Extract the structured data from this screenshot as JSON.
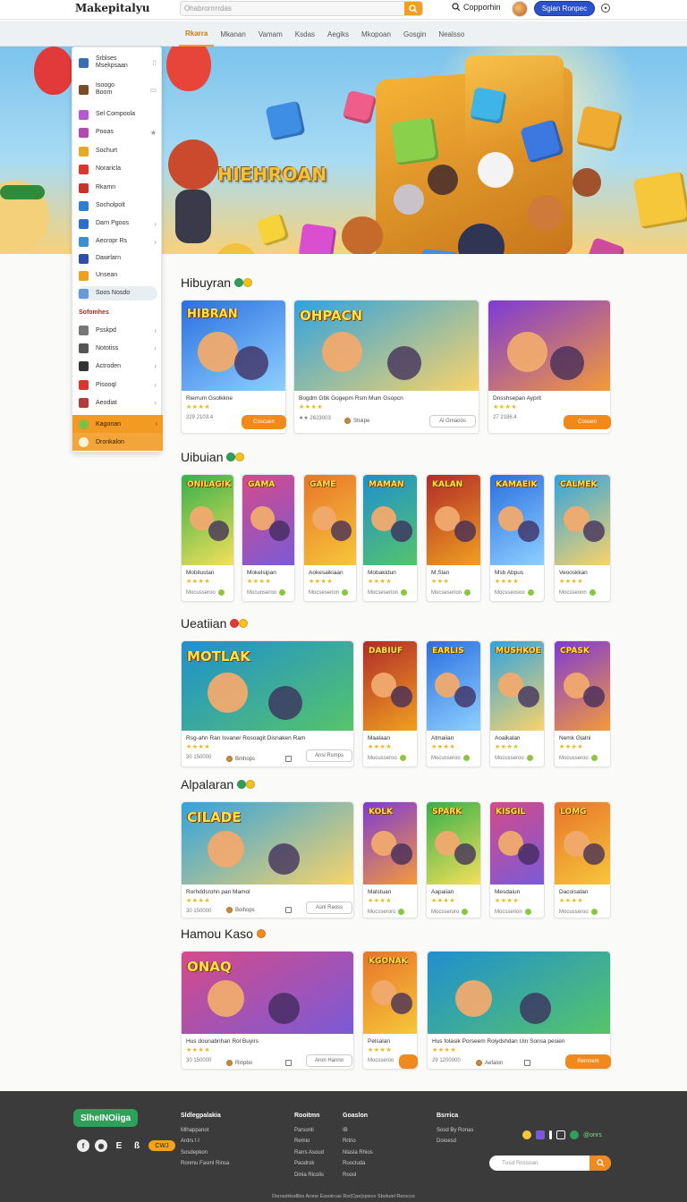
{
  "header": {
    "logo": "Makepitalyu",
    "search_placeholder": "Ohabrorrrrrdas",
    "link": "Copporhin",
    "signin": "Sgian Ronpec"
  },
  "nav": {
    "categories": [
      "Rkarra",
      "Mkanan",
      "Vamam",
      "Ksdas",
      "Aegiks",
      "Mkopoan",
      "Gosgin",
      "Nealsso"
    ]
  },
  "hero": {
    "title": "HIEHROAN"
  },
  "sidebar": {
    "items": [
      {
        "label": "Srblses\nMsekpsaan",
        "arrow": "⁞⁞",
        "color": "#3c6db3"
      },
      {
        "label": "Isoogo\nBoom",
        "arrow": "▭",
        "color": "#7a4c28"
      },
      {
        "label": "Sel Compoola",
        "arrow": "",
        "color": "#b55bd1"
      },
      {
        "label": "Pooas",
        "arrow": "★",
        "color": "#b04ab0"
      },
      {
        "label": "Sochurt",
        "arrow": "",
        "color": "#e8a82a"
      },
      {
        "label": "Noraricla",
        "arrow": "",
        "color": "#d9362d"
      },
      {
        "label": "Rkamn",
        "arrow": "",
        "color": "#c8322b"
      },
      {
        "label": "Socholpolt",
        "arrow": "",
        "color": "#2f7fcf"
      },
      {
        "label": "Darn Pgoos",
        "arrow": "›",
        "color": "#2b6fc7"
      },
      {
        "label": "Aecropr Rs",
        "arrow": "›",
        "color": "#3b8ed0"
      },
      {
        "label": "Dawrlarn",
        "arrow": "",
        "color": "#2c4fa8"
      },
      {
        "label": "Unsean",
        "arrow": "",
        "color": "#f0a020"
      },
      {
        "label": "Soos Nosdo",
        "arrow": "",
        "color": "#6a9ad6"
      }
    ],
    "section_title": "Sofomhes",
    "section_items": [
      {
        "label": "Psskpd",
        "arrow": "›",
        "color": "#777777"
      },
      {
        "label": "Nototiss",
        "arrow": "›",
        "color": "#555555"
      },
      {
        "label": "Actroden",
        "arrow": "›",
        "color": "#333333"
      },
      {
        "label": "Pisooql",
        "arrow": "›",
        "color": "#d9362d"
      },
      {
        "label": "Aeodiat",
        "arrow": "›",
        "color": "#b13b3b"
      }
    ],
    "promo_items": [
      {
        "label": "Kagonan",
        "arrow": "›"
      },
      {
        "label": "Dronkalon",
        "arrow": ""
      }
    ]
  },
  "sections": [
    {
      "title": "Hibuyran",
      "cards": [
        {
          "name": "Rierrum Gsolkkne",
          "stars": "★★★★",
          "meta": "229  2103.4",
          "button": "Coscuen",
          "art": "HIBRAN"
        },
        {
          "name": "Bogdm Gbk Gogepm Rsm Mum Gsopcn",
          "stars": "★★★★",
          "meta": "★★  2623003",
          "mini": "Stskpe",
          "button": "Al  Gmaoos",
          "art": "OHPACN"
        },
        {
          "name": "Dnsshsepan Ayprit",
          "stars": "★★★★",
          "meta": "27  2186.4",
          "button": "Cosuen",
          "art": ""
        }
      ]
    },
    {
      "title": "Uibuian",
      "cards": [
        {
          "name": "Mobilustan",
          "stars": "★★★★",
          "meta": "Mocusseroo",
          "art": "ONILAGIK"
        },
        {
          "name": "Mokelsipan",
          "stars": "★★★★",
          "meta": "Mocunseroo",
          "art": "GAMA"
        },
        {
          "name": "Aokesaikiaan",
          "stars": "★★★★",
          "meta": "Mocseserion",
          "art": "GAME"
        },
        {
          "name": "Mobakidun",
          "stars": "★★★★",
          "meta": "Mocseserion",
          "art": "MAMAN"
        },
        {
          "name": "M.Slan",
          "stars": "★★★",
          "meta": "Mocseserion",
          "art": "KALAN"
        },
        {
          "name": "Msb Abpus",
          "stars": "★★★★",
          "meta": "Mocsseosoo",
          "art": "KAMAEIK"
        },
        {
          "name": "Veooskkan",
          "stars": "★★★★",
          "meta": "Mocsseonn",
          "art": "CALMEK"
        }
      ]
    },
    {
      "title": "Ueatiian",
      "cards": [
        {
          "name": "Rsg-ahn Ran Isvaner Rosoagit Disnaken Ram",
          "stars": "★★★★",
          "meta": "30  150000",
          "mini": "Bmhops",
          "button": "Ansi Rsmps",
          "art": "MOTLAK"
        },
        {
          "name": "Maalaan",
          "stars": "★★★★",
          "meta": "Mocusseroo",
          "art": "DABIUF"
        },
        {
          "name": "Atmaiian",
          "stars": "★★★★",
          "meta": "Mocusseroo",
          "art": "EARLIS"
        },
        {
          "name": "Aoaikalan",
          "stars": "★★★★",
          "meta": "Mocusseroo",
          "art": "MUSHKOE"
        },
        {
          "name": "Nemk Glalni",
          "stars": "★★★★",
          "meta": "Mocusseroo",
          "art": "CPASK"
        }
      ]
    },
    {
      "title": "Alpalaran",
      "cards": [
        {
          "name": "Rorhddsrohn pan Mamol",
          "stars": "★★★★",
          "meta": "30  150000",
          "mini": "Boihops",
          "button": "Asni Raoss",
          "art": "CILADE"
        },
        {
          "name": "Malstuan",
          "stars": "★★★★",
          "meta": "Mocsseroro",
          "art": "KOLK"
        },
        {
          "name": "Aapaiian",
          "stars": "★★★★",
          "meta": "Mocsseroro",
          "art": "SPARK"
        },
        {
          "name": "Mesdaiun",
          "stars": "★★★★",
          "meta": "Mocsserion",
          "art": "KISGIL"
        },
        {
          "name": "Dacoisatan",
          "stars": "★★★★",
          "meta": "Mocusseroo",
          "art": "LOMG"
        }
      ]
    },
    {
      "title": "Hamou Kaso",
      "cards": [
        {
          "name": "Hus dounabnhan Rol Buyirs",
          "stars": "★★★★",
          "meta": "30  150000",
          "mini": "Rinpbo",
          "button": "Aron Hanno",
          "art": "ONAQ"
        },
        {
          "name": "Pelsalan",
          "stars": "★★★★",
          "meta": "Mocsseroo",
          "art": "KGONAK"
        },
        {
          "name": "Hus folasik Porseem Roiydshdan Uin Sonsa pesien",
          "stars": "★★★★",
          "meta": "29  1200000",
          "mini": "Aefalon",
          "button": "Remnem",
          "art": ""
        }
      ]
    }
  ],
  "footer": {
    "brand": "SlheINOiiga",
    "pill": "CWJ",
    "cols": [
      {
        "head": "Sldlegpalakia",
        "items": [
          "Mlhappanot",
          "Ardrs l·l",
          "Sosdepkon",
          "Ronmu Fasml Rinsa"
        ]
      },
      {
        "head": "Rooitmn",
        "items": [
          "Parsonli",
          "Remio",
          "Rarrs Asoud",
          "Paodrok",
          "Dinia Ricolis"
        ]
      },
      {
        "head": "Goaslon",
        "items": [
          "IB",
          "Rrtrio",
          "Nlasia Rhios",
          "Ruocluda",
          "Roosl"
        ]
      },
      {
        "head": "Bsrrica",
        "items": [
          "Sosd By Ronas",
          "Doioesd"
        ]
      }
    ],
    "tag": "@onrs",
    "search_placeholder": "Tusd Rrosoan",
    "copyright": "Dsrosdrksdlbis Arone Essotrcas Rsr|Cpe|spisce Sbotuiel Rerocos"
  }
}
